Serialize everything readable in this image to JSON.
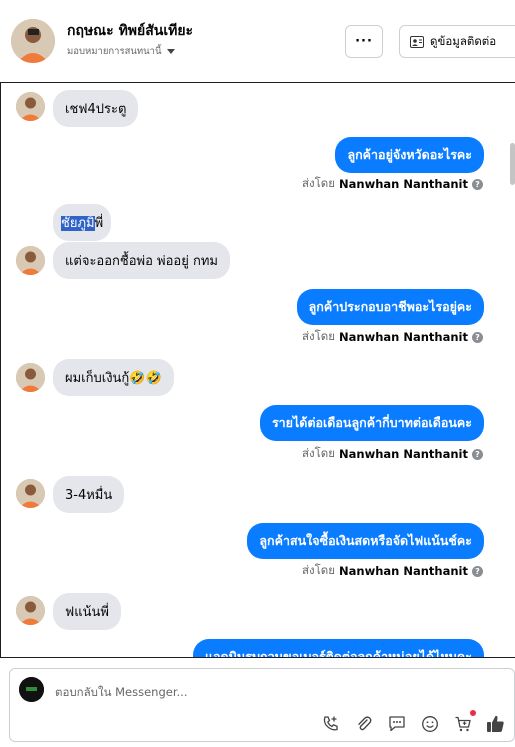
{
  "header": {
    "name": "กฤษณะ ทิพย์สันเทียะ",
    "assign_label": "มอบหมายการสนทนานี้",
    "more_label": "···",
    "contact_label": "ดูข้อมูลติดต่อ"
  },
  "messages": {
    "m1": "เชฟ4ประตู",
    "m2": "ลูกค้าอยู่จังหวัดอะไรคะ",
    "m3_highlight": "ชัยภูมิ",
    "m3_rest": "พี่",
    "m4": "แต่จะออกชื้อพ่อ พ่ออยู่ กทม",
    "m5": "ลูกค้าประกอบอาชีพอะไรอยู่คะ",
    "m6": "ผมเก็บเงินกู้🤣🤣",
    "m7": "รายได้ต่อเดือนลูกค้ากี่บาทต่อเดือนคะ",
    "m8": "3-4หมื่น",
    "m9": "ลูกค้าสนใจซื้อเงินสดหรือจัดไฟแน้นช์คะ",
    "m10": "ฟแน้นพี่",
    "m11": "แอดมินรบกวนขอเบอร์ติดต่อลูกค้าหน่อยได้ไหมคะ"
  },
  "sent_by": {
    "prefix": "ส่งโดย",
    "agent": "Nanwhan Nanthanit"
  },
  "composer": {
    "placeholder": "ตอบกลับใน Messenger..."
  },
  "icons": {
    "tools": [
      "call-add-icon",
      "attach-icon",
      "chat-template-icon",
      "emoji-icon",
      "cart-icon",
      "like-icon"
    ]
  },
  "colors": {
    "outgoing": "#0a7cff",
    "incoming": "#e4e6eb"
  }
}
